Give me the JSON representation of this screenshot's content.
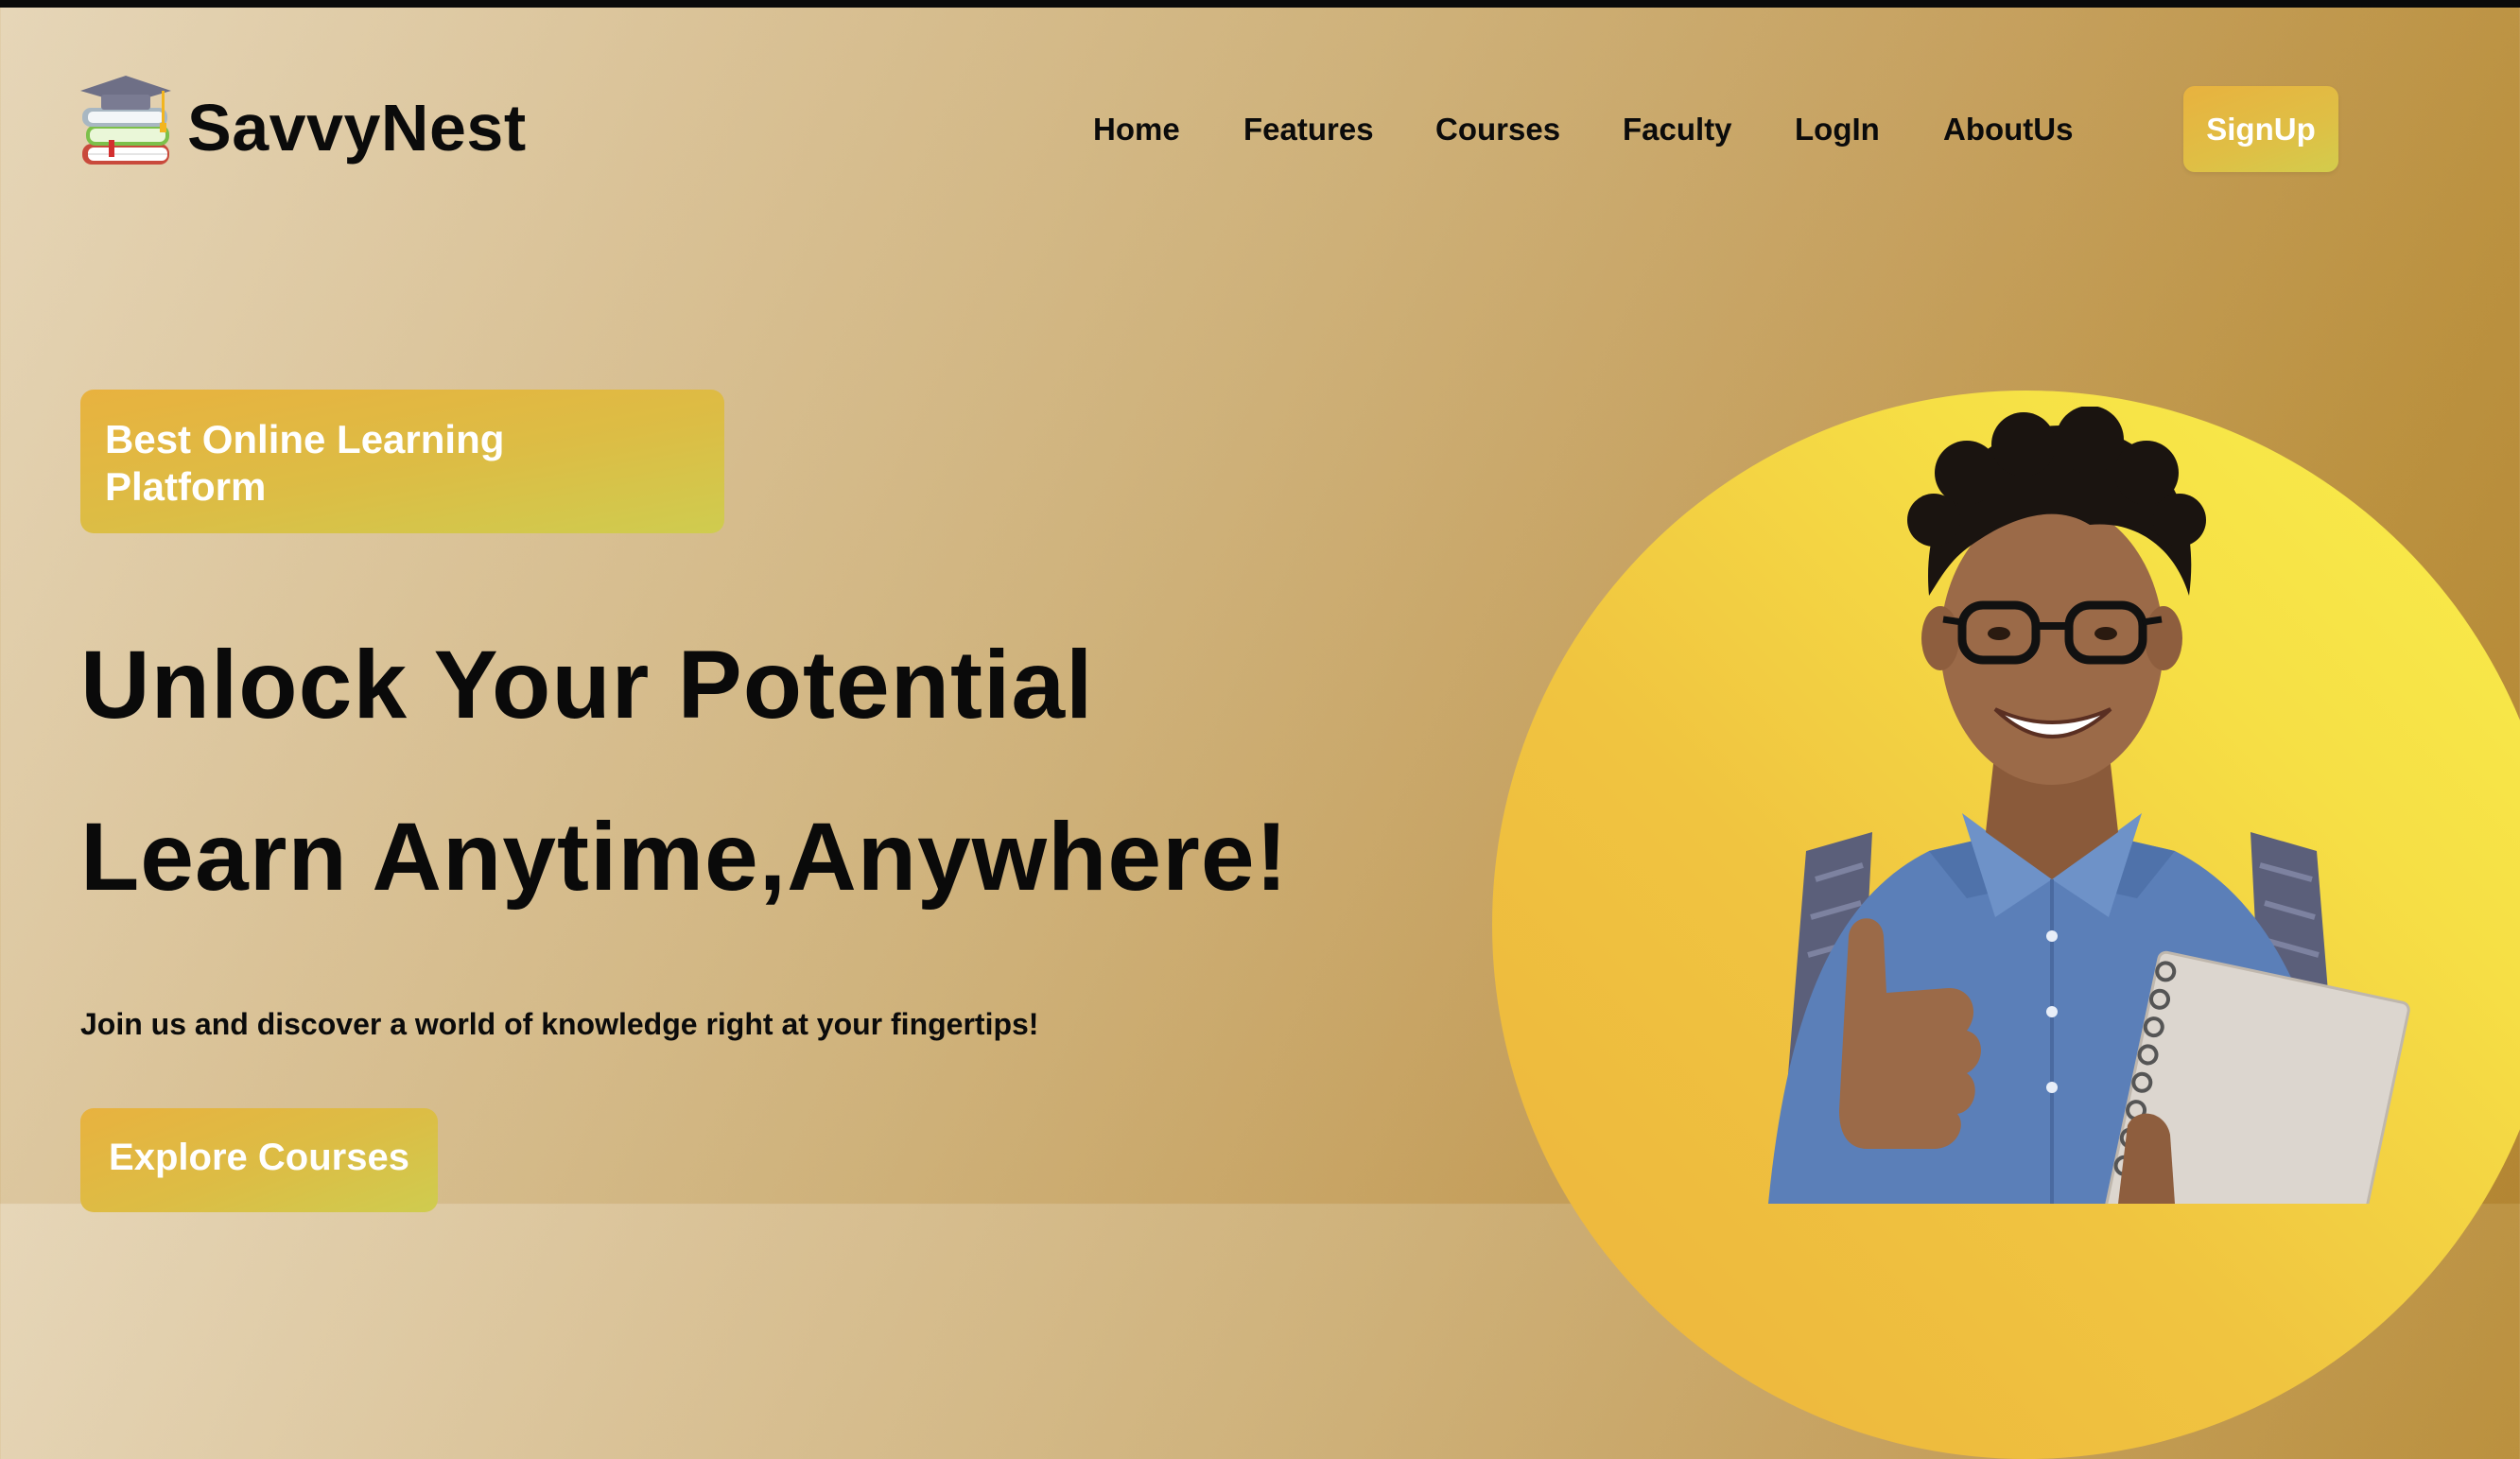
{
  "brand": {
    "name": "SavvyNest",
    "logo_icon": "graduation-cap-books-icon"
  },
  "nav": {
    "items": [
      "Home",
      "Features",
      "Courses",
      "Faculty",
      "LogIn",
      "AboutUs"
    ],
    "signup_label": "SignUp"
  },
  "hero": {
    "badge": "Best Online Learning Platform",
    "headline_line1": "Unlock Your Potential",
    "headline_line2": "Learn Anytime,Anywhere!",
    "subtext": "Join us and discover a world of knowledge right at your fingertips!",
    "cta_label": "Explore Courses",
    "image_icon": "student-thumbs-up-illustration"
  },
  "colors": {
    "accent": "#e8b23f",
    "accent_2": "#d3cc4c",
    "circle_light": "#f9ef4c",
    "circle_dark": "#ecb33c",
    "text": "#0b0b0b",
    "topbar": "#0a0a0a"
  }
}
